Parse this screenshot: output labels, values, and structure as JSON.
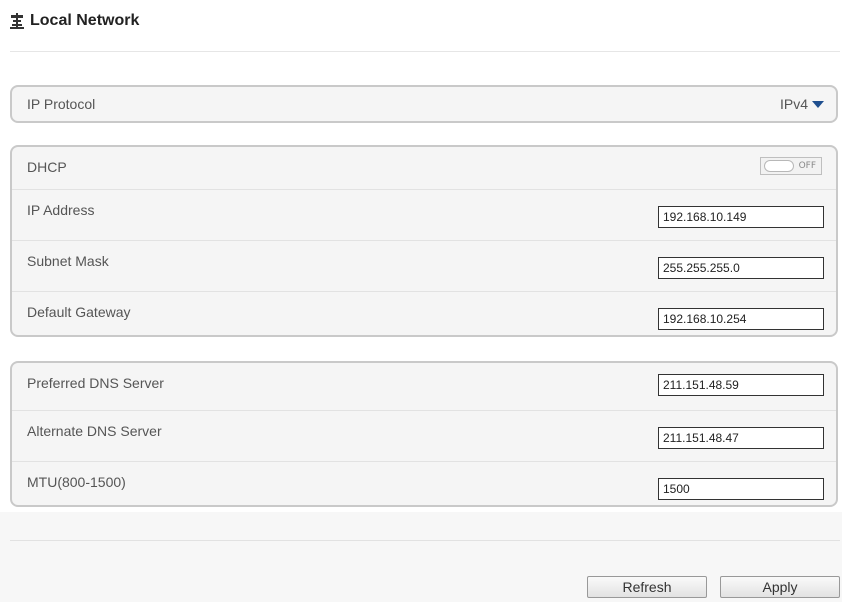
{
  "page": {
    "title": "Local Network",
    "icon": "network-signpost-icon"
  },
  "ip_protocol": {
    "label": "IP Protocol",
    "value": "IPv4"
  },
  "dhcp": {
    "label": "DHCP",
    "state": "OFF"
  },
  "addresses": {
    "ip_address": {
      "label": "IP Address",
      "value": "192.168.10.149"
    },
    "subnet_mask": {
      "label": "Subnet Mask",
      "value": "255.255.255.0"
    },
    "default_gateway": {
      "label": "Default Gateway",
      "value": "192.168.10.254"
    }
  },
  "dns": {
    "preferred": {
      "label": "Preferred DNS Server",
      "value": "211.151.48.59"
    },
    "alternate": {
      "label": "Alternate DNS Server",
      "value": "211.151.48.47"
    },
    "mtu": {
      "label": "MTU(800-1500)",
      "value": "1500"
    }
  },
  "buttons": {
    "refresh": "Refresh",
    "apply": "Apply"
  },
  "colors": {
    "caret": "#1f4f8f",
    "panel_border": "#c9c9c9",
    "panel_bg": "#f5f5f5"
  }
}
